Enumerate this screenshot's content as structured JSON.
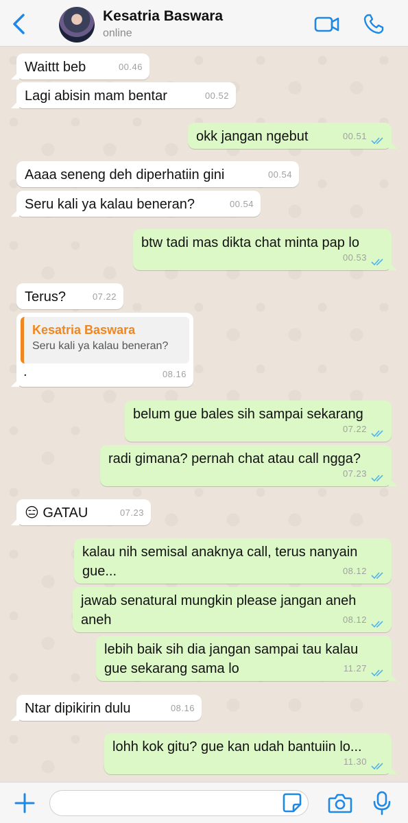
{
  "header": {
    "contact_name": "Kesatria Baswara",
    "status": "online",
    "accent_color": "#1e88e5"
  },
  "messages": [
    {
      "dir": "in",
      "text": "Waittt beb",
      "time": "00.46"
    },
    {
      "dir": "in",
      "text": "Lagi abisin mam bentar",
      "time": "00.52"
    },
    {
      "dir": "out",
      "text": "okk jangan ngebut",
      "time": "00.51"
    },
    {
      "dir": "in",
      "text": "Aaaa seneng deh diperhatiin gini",
      "time": "00.54"
    },
    {
      "dir": "in",
      "text": "Seru kali ya kalau beneran?",
      "time": "00.54"
    },
    {
      "dir": "out",
      "text": "btw tadi mas dikta chat minta pap lo",
      "time": "00.53"
    },
    {
      "dir": "in",
      "text": "Terus?",
      "time": "07.22"
    },
    {
      "dir": "in",
      "text": ".",
      "time": "08.16",
      "quote": {
        "name": "Kesatria Baswara",
        "text": "Seru kali ya kalau beneran?"
      }
    },
    {
      "dir": "out",
      "text": "belum gue bales sih sampai sekarang",
      "time": "07.22"
    },
    {
      "dir": "out",
      "text": "radi gimana? pernah chat atau call ngga?",
      "time": "07.23"
    },
    {
      "dir": "in",
      "text": "😑 GATAU",
      "time": "07.23"
    },
    {
      "dir": "out",
      "text": "kalau nih semisal anaknya call, terus nanyain gue...",
      "time": "08.12"
    },
    {
      "dir": "out",
      "text": "jawab senatural mungkin please jangan aneh aneh",
      "time": "08.12"
    },
    {
      "dir": "out",
      "text": "lebih baik sih dia jangan sampai tau kalau gue sekarang sama lo",
      "time": "11.27"
    },
    {
      "dir": "in",
      "text": "Ntar dipikirin dulu",
      "time": "08.16"
    },
    {
      "dir": "out",
      "text": "lohh kok gitu? gue kan udah bantuiin lo...",
      "time": "11.30"
    }
  ],
  "composer": {
    "placeholder": ""
  },
  "icons": [
    "back-arrow-icon",
    "video-call-icon",
    "phone-icon",
    "plus-icon",
    "sticker-icon",
    "camera-icon",
    "mic-icon",
    "double-check-icon"
  ]
}
